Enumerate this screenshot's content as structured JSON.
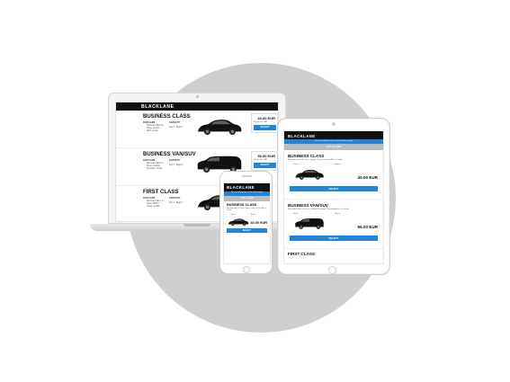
{
  "brand": "BLACKLANE",
  "colors": {
    "accent": "#1e87d9",
    "topbar": "#111111",
    "circle": "#cfcfcf",
    "tab": "#bdbdbd"
  },
  "laptop": {
    "classes": [
      {
        "title": "BUSINESS CLASS",
        "our_cars_label": "OUR CARS",
        "capacity_label": "CAPACITY",
        "cars_desc": "Mercedes-Benz E-Class, Lincoln MKZ, similar",
        "capacity": "Pax 3 · Bags 2",
        "price": "40.00 EUR",
        "fee_note": "Prices incl. VAT",
        "select_label": "SELECT"
      },
      {
        "title": "BUSINESS VAN/SUV",
        "our_cars_label": "OUR CARS",
        "capacity_label": "CAPACITY",
        "cars_desc": "Mercedes-Benz V-Class, Cadillac Escalade, similar",
        "capacity": "Pax 5 · Bags 5",
        "price": "56.00 EUR",
        "fee_note": "Prices incl. VAT",
        "select_label": "SELECT"
      },
      {
        "title": "FIRST CLASS",
        "our_cars_label": "OUR CARS",
        "capacity_label": "CAPACITY",
        "cars_desc": "Mercedes-Benz S-Class, BMW 7 Series, similar",
        "capacity": "Pax 3 · Bags 2",
        "price": "",
        "fee_note": "",
        "select_label": ""
      }
    ]
  },
  "tablet": {
    "notice": "Free cancellation up to 1 hour before pickup",
    "tab_label": "1ST CLASS",
    "classes": [
      {
        "title": "BUSINESS CLASS",
        "desc": "Mercedes-Benz E-Class, Toyota Camry, Lincoln MKZ or similar",
        "pax": "Pax 3",
        "bags": "Bags 2",
        "price": "40.00 EUR",
        "select_label": "SELECT"
      },
      {
        "title": "BUSINESS VAN/SUV",
        "desc": "Mercedes-Benz V-Class, Cadillac Escalade, Toyota Alphard, or similar",
        "pax": "Pax 5",
        "bags": "Bags 5",
        "price": "56.00 EUR",
        "select_label": "SELECT"
      }
    ],
    "next_title": "FIRST CLASS"
  },
  "phone": {
    "notice": "Free cancellation up to 1 hour before pickup",
    "tab_label": "1ST CLASS",
    "title": "BUSINESS CLASS",
    "desc": "Mercedes-Benz E-Class, Toyota Camry, Lincoln MKZ or similar",
    "pax": "Pax 3",
    "bags": "Bags 2",
    "price": "40.00 EUR",
    "select_label": "SELECT"
  }
}
